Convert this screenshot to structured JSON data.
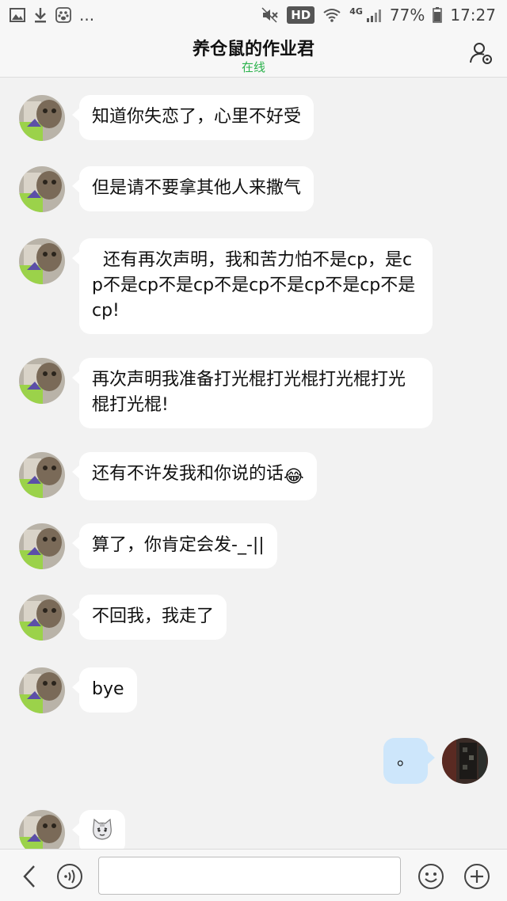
{
  "status_bar": {
    "left_icons": [
      "image-icon",
      "download-icon",
      "paw-icon"
    ],
    "more": "...",
    "hd": "HD",
    "network": "4G",
    "battery": "77%",
    "time": "17:27"
  },
  "header": {
    "title": "养仓鼠的作业君",
    "subtitle": "在线",
    "profile_icon": "person-settings-icon"
  },
  "messages": [
    {
      "side": "left",
      "text": "知道你失恋了，心里不好受"
    },
    {
      "side": "left",
      "text": "但是请不要拿其他人来撒气"
    },
    {
      "side": "left",
      "text": "  还有再次声明，我和苦力怕不是cp，是cp不是cp不是cp不是cp不是cp不是cp不是cp!"
    },
    {
      "side": "left",
      "text": "再次声明我准备打光棍打光棍打光棍打光棍打光棍!"
    },
    {
      "side": "left",
      "text": "还有不许发我和你说的话",
      "emoji": "😂"
    },
    {
      "side": "left",
      "text": "算了，你肯定会发-_-||"
    },
    {
      "side": "left",
      "text": "不回我，我走了"
    },
    {
      "side": "left",
      "text": "bye"
    },
    {
      "side": "right",
      "text": "。"
    },
    {
      "side": "left",
      "text": "",
      "emoji": "cat-face-emoji"
    }
  ],
  "input_bar": {
    "back_icon": "chevron-left-icon",
    "voice_icon": "voice-icon",
    "input_value": "",
    "emoji_icon": "smiley-icon",
    "add_icon": "plus-circle-icon"
  },
  "colors": {
    "online_green": "#2bb24c",
    "incoming_bubble": "#ffffff",
    "outgoing_bubble": "#cde6fb",
    "background": "#f2f2f2"
  }
}
